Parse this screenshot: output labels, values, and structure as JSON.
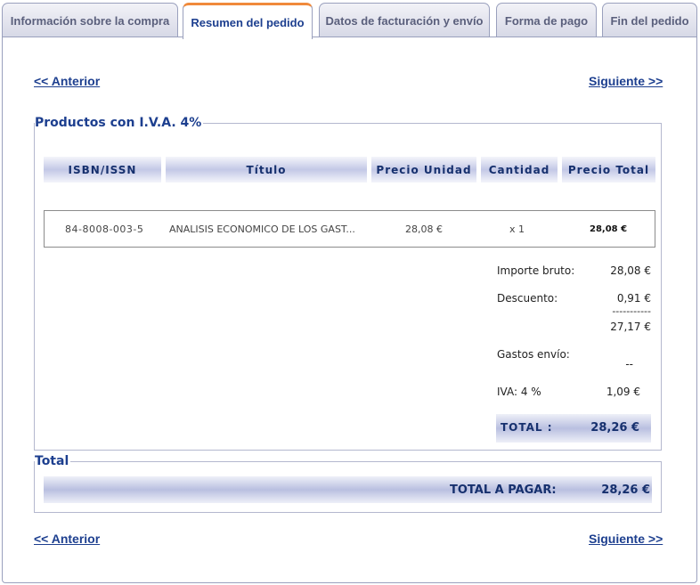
{
  "tabs": [
    {
      "label": "Información sobre la compra"
    },
    {
      "label": "Resumen del pedido"
    },
    {
      "label": "Datos de facturación y envío"
    },
    {
      "label": "Forma de pago"
    },
    {
      "label": "Fin del pedido"
    }
  ],
  "active_tab": "Resumen del pedido",
  "nav": {
    "prev": "<< Anterior",
    "next": "Siguiente >>"
  },
  "products_section": {
    "legend": "Productos con I.V.A. 4%",
    "columns": [
      "ISBN/ISSN",
      "Título",
      "Precio Unidad",
      "Cantidad",
      "Precio Total"
    ],
    "rows": [
      {
        "isbn": "84-8008-003-5",
        "title": "ANALISIS ECONOMICO DE LOS GAST...",
        "unit_price": "28,08 €",
        "quantity": "x 1",
        "total_price": "28,08 €"
      }
    ],
    "summary": {
      "gross_label": "Importe bruto:",
      "gross_value": "28,08 €",
      "discount_label": "Descuento:",
      "discount_value": "0,91 €",
      "separator": "-----------",
      "subtotal_value": "27,17 €",
      "shipping_label": "Gastos envío:",
      "shipping_value": "--",
      "vat_label": "IVA: 4 %",
      "vat_value": "1,09 €",
      "total_label": "TOTAL :",
      "total_value": "28,26 €"
    }
  },
  "total_section": {
    "legend": "Total",
    "pay_label": "TOTAL A PAGAR:",
    "pay_value": "28,26 €"
  },
  "colors": {
    "accent": "#1d3f8f",
    "active_tab_border": "#f08a3c",
    "header_bar": "#c3c8e6"
  }
}
